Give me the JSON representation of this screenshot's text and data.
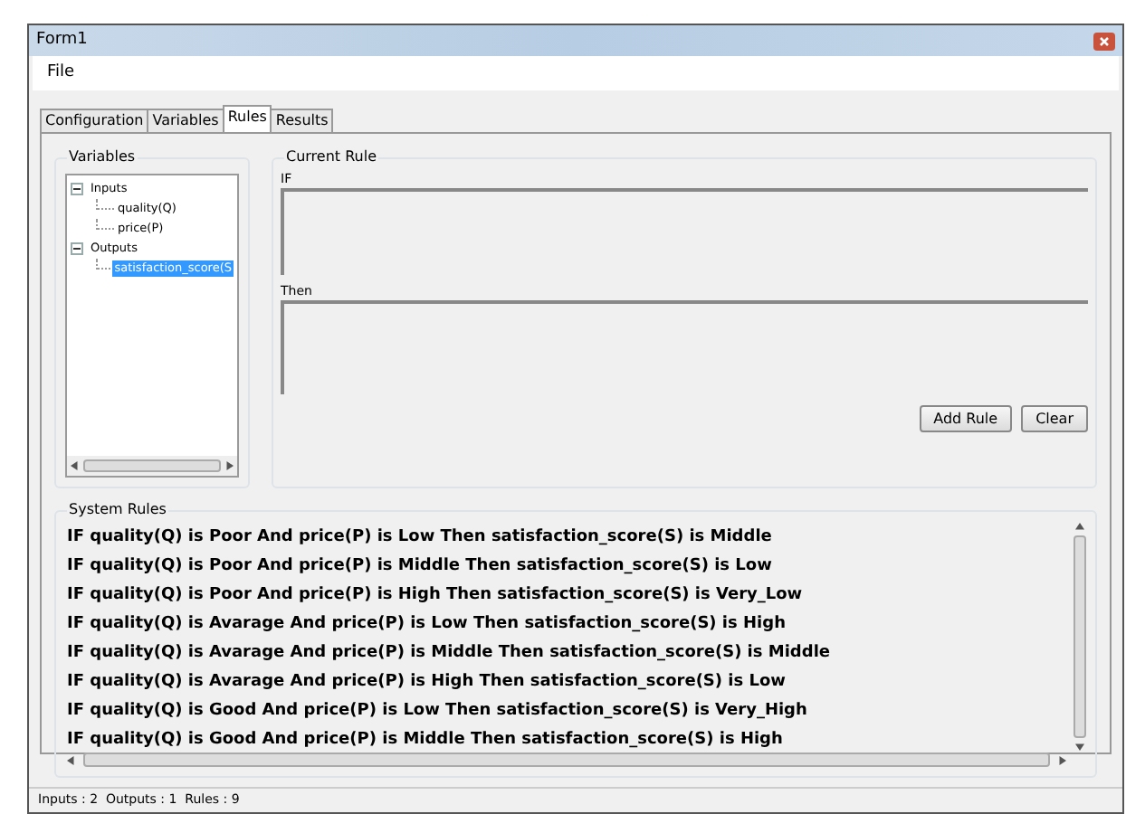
{
  "window": {
    "title": "Form1"
  },
  "menu": [
    "File"
  ],
  "tabs": [
    {
      "label": "Configuration",
      "selected": false
    },
    {
      "label": "Variables",
      "selected": false
    },
    {
      "label": "Rules",
      "selected": true
    },
    {
      "label": "Results",
      "selected": false
    }
  ],
  "variables": {
    "title": "Variables",
    "tree": [
      {
        "label": "Inputs",
        "expanded": true,
        "selected": false,
        "children": [
          {
            "label": "quality(Q)",
            "selected": false
          },
          {
            "label": "price(P)",
            "selected": false
          }
        ]
      },
      {
        "label": "Outputs",
        "expanded": true,
        "selected": false,
        "children": [
          {
            "label": "satisfaction_score(S",
            "selected": true
          }
        ]
      }
    ]
  },
  "current_rule": {
    "title": "Current Rule",
    "if_label": "IF",
    "then_label": "Then",
    "buttons": [
      "Add Rule",
      "Clear"
    ]
  },
  "system_rules": {
    "title": "System Rules",
    "rows": [
      "IF quality(Q) is Poor And price(P) is Low Then satisfaction_score(S) is Middle",
      "IF quality(Q) is Poor And price(P) is Middle Then satisfaction_score(S) is Low",
      "IF quality(Q) is Poor And price(P) is High Then satisfaction_score(S) is Very_Low",
      "IF quality(Q) is Avarage And price(P) is Low Then satisfaction_score(S) is High",
      "IF quality(Q) is Avarage And price(P) is Middle Then satisfaction_score(S) is Middle",
      "IF quality(Q) is Avarage And price(P) is High Then satisfaction_score(S) is Low",
      "IF quality(Q) is Good And price(P) is Low Then satisfaction_score(S) is Very_High",
      "IF quality(Q) is Good And price(P) is Middle Then satisfaction_score(S) is High"
    ]
  },
  "status_bar": "Inputs : 2  Outputs : 1  Rules : 9"
}
